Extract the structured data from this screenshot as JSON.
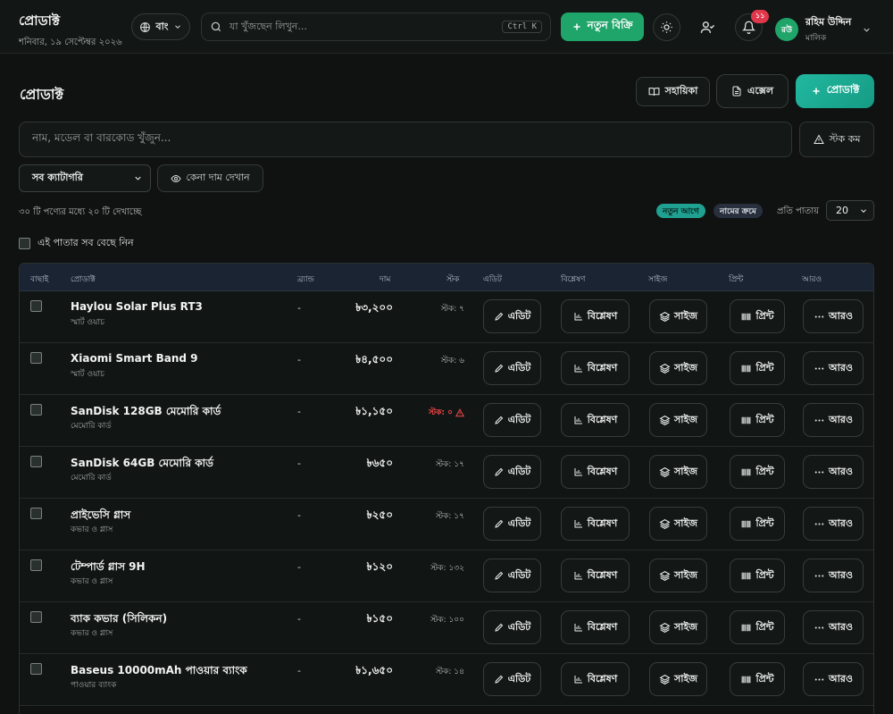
{
  "header": {
    "title": "প্রোডাক্ট",
    "date": "শনিবার, ১৯ সেপ্টেম্বর ২০২৬",
    "language": "বাং",
    "search_placeholder": "যা খুঁজছেন লিখুন...",
    "search_shortcut": "Ctrl K",
    "new_sale_label": "নতুন বিক্রি",
    "notification_count": "১১",
    "user_initials": "রউ",
    "user_name": "রহিম উদ্দিন",
    "user_role": "মালিক"
  },
  "page": {
    "title": "প্রোডাক্ট",
    "guide_label": "সহায়িকা",
    "excel_label": "এক্সেল",
    "add_product_label": "প্রোডাক্ট",
    "search_placeholder": "নাম, মডেল বা বারকোড খুঁজুন...",
    "low_stock_label": "স্টক কম",
    "category_selected": "সব ক্যাটাগরি",
    "show_cost_label": "কেনা দাম দেখান",
    "count_text": "৩০ টি পণ্যের মধ্যে ২০ টি দেখাচ্ছে",
    "sort_newest": "নতুন আগে",
    "sort_name": "নামের ক্রমে",
    "per_page_label": "প্রতি পাতায়",
    "per_page_value": "20",
    "select_all_label": "এই পাতার সব বেছে নিন"
  },
  "table": {
    "headers": {
      "select": "বাছাই",
      "product": "প্রোডাক্ট",
      "brand": "ব্র্যান্ড",
      "price": "দাম",
      "stock": "স্টক",
      "edit": "এডিট",
      "analysis": "বিশ্লেষণ",
      "size": "সাইজ",
      "print": "প্রিন্ট",
      "more": "আরও"
    },
    "action_labels": {
      "edit": "এডিট",
      "analysis": "বিশ্লেষণ",
      "size": "সাইজ",
      "print": "প্রিন্ট",
      "more": "আরও"
    },
    "rows": [
      {
        "name": "Haylou Solar Plus RT3",
        "category": "স্মার্ট ওয়াচ",
        "brand": "-",
        "price": "৳৩,২০০",
        "stock": "স্টক: ৭",
        "low": false
      },
      {
        "name": "Xiaomi Smart Band 9",
        "category": "স্মার্ট ওয়াচ",
        "brand": "-",
        "price": "৳৪,৫০০",
        "stock": "স্টক: ৬",
        "low": false
      },
      {
        "name": "SanDisk 128GB মেমোরি কার্ড",
        "category": "মেমোরি কার্ড",
        "brand": "-",
        "price": "৳১,১৫০",
        "stock": "স্টক: ০",
        "low": true
      },
      {
        "name": "SanDisk 64GB মেমোরি কার্ড",
        "category": "মেমোরি কার্ড",
        "brand": "-",
        "price": "৳৬৫০",
        "stock": "স্টক: ১৭",
        "low": false
      },
      {
        "name": "প্রাইভেসি গ্লাস",
        "category": "কভার ও গ্লাস",
        "brand": "-",
        "price": "৳২৫০",
        "stock": "স্টক: ১৭",
        "low": false
      },
      {
        "name": "টেম্পার্ড গ্লাস 9H",
        "category": "কভার ও গ্লাস",
        "brand": "-",
        "price": "৳১২০",
        "stock": "স্টক: ১৩২",
        "low": false
      },
      {
        "name": "ব্যাক কভার (সিলিকন)",
        "category": "কভার ও গ্লাস",
        "brand": "-",
        "price": "৳১৫০",
        "stock": "স্টক: ১০০",
        "low": false
      },
      {
        "name": "Baseus 10000mAh পাওয়ার ব্যাংক",
        "category": "পাওয়ার ব্যাংক",
        "brand": "-",
        "price": "৳১,৬৫০",
        "stock": "স্টক: ১৪",
        "low": false
      }
    ]
  },
  "colors": {
    "accent_green": "#1fa46a",
    "accent_teal": "#1aa98f",
    "danger": "#ef4747",
    "background": "#0f1211"
  }
}
